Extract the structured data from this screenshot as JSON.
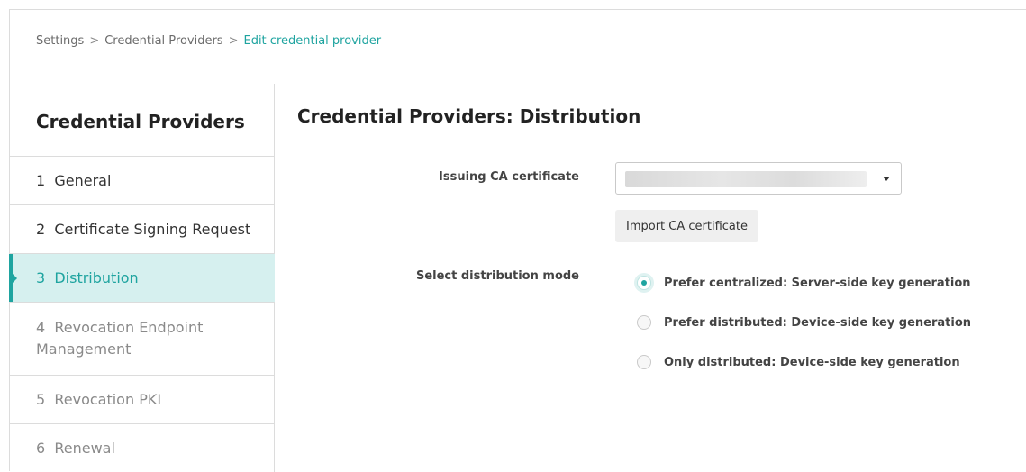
{
  "breadcrumb": {
    "items": [
      "Settings",
      "Credential Providers"
    ],
    "separator": ">",
    "current": "Edit credential provider"
  },
  "sidebar": {
    "title": "Credential Providers",
    "steps": [
      {
        "label": "1  General",
        "state": "normal"
      },
      {
        "label": "2  Certificate Signing Request",
        "state": "normal"
      },
      {
        "label": "3  Distribution",
        "state": "active"
      },
      {
        "label": "4  Revocation Endpoint",
        "label2": "Management",
        "state": "muted"
      },
      {
        "label": "5  Revocation PKI",
        "state": "muted"
      },
      {
        "label": "6  Renewal",
        "state": "muted"
      }
    ]
  },
  "main": {
    "title": "Credential Providers: Distribution",
    "issuing_ca": {
      "label": "Issuing CA certificate",
      "value": ""
    },
    "import_button": "Import CA certificate",
    "distribution_mode": {
      "label": "Select distribution mode",
      "options": [
        {
          "label": "Prefer centralized: Server-side key generation",
          "selected": true
        },
        {
          "label": "Prefer distributed: Device-side key generation",
          "selected": false
        },
        {
          "label": "Only distributed: Device-side key generation",
          "selected": false
        }
      ]
    }
  },
  "colors": {
    "accent": "#1fa4a0",
    "active_bg": "#d6f0ef",
    "border": "#dcdcdc"
  }
}
